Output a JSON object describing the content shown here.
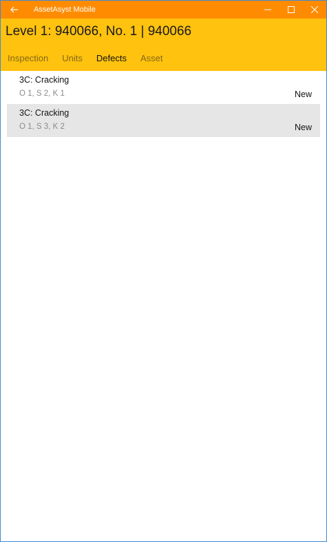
{
  "window": {
    "app_title": "AssetAsyst Mobile",
    "icons": {
      "back": "back-arrow-icon",
      "minimize": "minimize-icon",
      "maximize": "maximize-icon",
      "close": "close-icon"
    }
  },
  "header": {
    "title": "Level 1: 940066, No. 1 | 940066",
    "tabs": [
      {
        "label": "Inspection",
        "active": false
      },
      {
        "label": "Units",
        "active": false
      },
      {
        "label": "Defects",
        "active": true
      },
      {
        "label": "Asset",
        "active": false
      }
    ]
  },
  "defects": [
    {
      "title": "3C: Cracking",
      "ratings": "O 1, S 2, K 1",
      "status": "New",
      "selected": false
    },
    {
      "title": "3C: Cracking",
      "ratings": "O 1, S 3, K 2",
      "status": "New",
      "selected": true
    }
  ],
  "colors": {
    "titlebar": "#ff8c00",
    "header": "#ffc20e",
    "selected_row": "#e6e6e6",
    "window_border": "#3c8bd9"
  }
}
